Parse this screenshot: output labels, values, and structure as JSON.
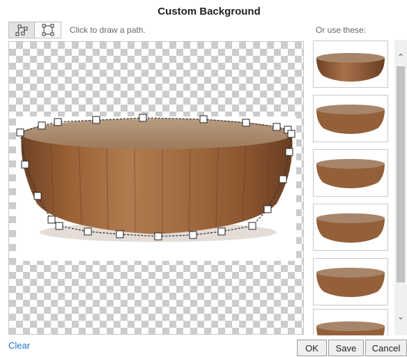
{
  "dialog": {
    "title": "Custom Background"
  },
  "toolbar": {
    "hint": "Click to draw a path.",
    "tools": [
      {
        "name": "path-tool",
        "icon": "polygon-path-icon"
      },
      {
        "name": "rectangle-tool",
        "icon": "rectangle-select-icon"
      }
    ]
  },
  "side_panel": {
    "label": "Or use these:",
    "thumbnails": [
      "table-thumbnail",
      "table-thumbnail",
      "table-thumbnail",
      "table-thumbnail",
      "table-thumbnail",
      "table-thumbnail"
    ]
  },
  "footer": {
    "clear_label": "Clear",
    "ok_label": "OK",
    "save_label": "Save",
    "cancel_label": "Cancel"
  },
  "colors": {
    "link": "#1a73c8",
    "wood_light": "#b68258",
    "wood_dark": "#6e4124",
    "path_outline": "#333333"
  }
}
